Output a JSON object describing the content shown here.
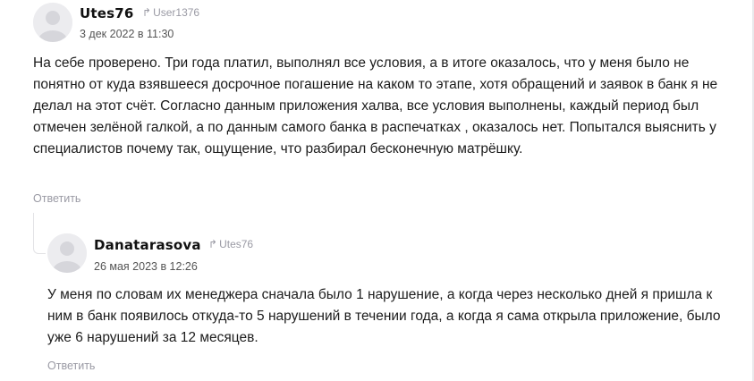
{
  "comments": [
    {
      "author": "Utes76",
      "reply_to": "User1376",
      "date": "3 дек 2022 в 11:30",
      "text": "На себе проверено. Три года платил, выполнял все условия, а в итоге оказалось, что у меня было не понятно от куда взявшееся досрочное погашение на каком то этапе, хотя обращений и заявок в банк я не делал на этот счёт. Согласно данным приложения халва, все условия выполнены, каждый период был отмечен зелёной галкой, а по данным самого банка в распечатках , оказалось нет. Попытался выяснить у специалистов почему так, ощущение, что разбирал бесконечную матрёшку.",
      "reply_label": "Ответить"
    },
    {
      "author": "Danatarasova",
      "reply_to": "Utes76",
      "date": "26 мая 2023 в 12:26",
      "text": "У меня по словам их менеджера сначала было 1 нарушение, а когда через несколько дней я пришла к ним в банк появилось откуда-то 5 нарушений в течении года, а когда я сама открыла приложение, было уже 6 нарушений за 12 месяцев.",
      "reply_label": "Ответить"
    }
  ],
  "icons": {
    "reply_arrow": "reply-arrow-icon",
    "avatar": "user-avatar-icon"
  }
}
